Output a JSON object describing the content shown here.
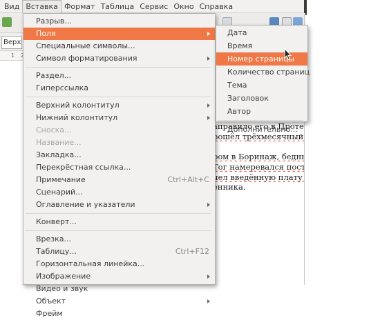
{
  "menubar": {
    "items": [
      {
        "label": "Вид",
        "active": false
      },
      {
        "label": "Вставка",
        "active": true
      },
      {
        "label": "Формат",
        "active": false
      },
      {
        "label": "Таблица",
        "active": false
      },
      {
        "label": "Сервис",
        "active": false
      },
      {
        "label": "Окно",
        "active": false
      },
      {
        "label": "Справка",
        "active": false
      }
    ]
  },
  "toolbar": {
    "style_box_value": "Верхний колонтитул"
  },
  "ruler": {
    "marks": [
      "1",
      "2"
    ]
  },
  "insert_menu": {
    "groups": [
      [
        {
          "label": "Разрыв...",
          "shortcut": "",
          "submenu": false,
          "disabled": false
        },
        {
          "label": "Поля",
          "shortcut": "",
          "submenu": true,
          "disabled": false,
          "highlighted": true
        },
        {
          "label": "Специальные символы...",
          "shortcut": "",
          "submenu": false,
          "disabled": false
        },
        {
          "label": "Символ форматирования",
          "shortcut": "",
          "submenu": true,
          "disabled": false
        }
      ],
      [
        {
          "label": "Раздел...",
          "shortcut": "",
          "submenu": false,
          "disabled": false
        },
        {
          "label": "Гиперссылка",
          "shortcut": "",
          "submenu": false,
          "disabled": false
        }
      ],
      [
        {
          "label": "Верхний колонтитул",
          "shortcut": "",
          "submenu": true,
          "disabled": false
        },
        {
          "label": "Нижний колонтитул",
          "shortcut": "",
          "submenu": true,
          "disabled": false
        },
        {
          "label": "Сноска...",
          "shortcut": "",
          "submenu": false,
          "disabled": true
        },
        {
          "label": "Название...",
          "shortcut": "",
          "submenu": false,
          "disabled": true
        },
        {
          "label": "Закладка...",
          "shortcut": "",
          "submenu": false,
          "disabled": false
        },
        {
          "label": "Перекрёстная ссылка...",
          "shortcut": "",
          "submenu": false,
          "disabled": false
        },
        {
          "label": "Примечание",
          "shortcut": "Ctrl+Alt+C",
          "submenu": false,
          "disabled": false
        },
        {
          "label": "Сценарий...",
          "shortcut": "",
          "submenu": false,
          "disabled": false
        },
        {
          "label": "Оглавление и указатели",
          "shortcut": "",
          "submenu": true,
          "disabled": false
        }
      ],
      [
        {
          "label": "Конверт...",
          "shortcut": "",
          "submenu": false,
          "disabled": false
        }
      ],
      [
        {
          "label": "Врезка...",
          "shortcut": "",
          "submenu": false,
          "disabled": false
        },
        {
          "label": "Таблицу...",
          "shortcut": "Ctrl+F12",
          "submenu": false,
          "disabled": false
        },
        {
          "label": "Горизонтальная линейка...",
          "shortcut": "",
          "submenu": false,
          "disabled": false
        },
        {
          "label": "Изображение",
          "shortcut": "",
          "submenu": true,
          "disabled": false
        },
        {
          "label": "Видео и звук",
          "shortcut": "",
          "submenu": false,
          "disabled": false
        },
        {
          "label": "Объект",
          "shortcut": "",
          "submenu": true,
          "disabled": false
        },
        {
          "label": "Фрейм",
          "shortcut": "",
          "submenu": false,
          "disabled": false
        }
      ]
    ]
  },
  "fields_menu": {
    "groups": [
      [
        {
          "label": "Дата",
          "highlighted": false
        },
        {
          "label": "Время",
          "highlighted": false
        },
        {
          "label": "Номер страницы",
          "highlighted": true
        },
        {
          "label": "Количество страниц",
          "highlighted": false
        },
        {
          "label": "Тема",
          "highlighted": false
        },
        {
          "label": "Заголовок",
          "highlighted": false
        },
        {
          "label": "Автор",
          "highlighted": false
        }
      ],
      [
        {
          "label": "Дополнительно...",
          "highlighted": false
        }
      ]
    ]
  },
  "document": {
    "lines": [
      {
        "text": "аправило его в Протестант",
        "spell": false
      },
      {
        "text": "рошёл трёхмесячный курс",
        "spell": true
      },
      {
        "text": "ром в Боринаж, бедный ша",
        "spell": true
      },
      {
        "text": "Тог намеревался поступить",
        "spell": true
      },
      {
        "text": "чел введённую плату за об",
        "spell": true
      },
      {
        "text": "енника.",
        "spell": false
      }
    ]
  },
  "colors": {
    "highlight": "#f07746",
    "menu_bg": "#f2f1f0"
  },
  "icons": {
    "cursor": "mouse-pointer-icon",
    "submenu_arrow": "chevron-right-icon"
  }
}
